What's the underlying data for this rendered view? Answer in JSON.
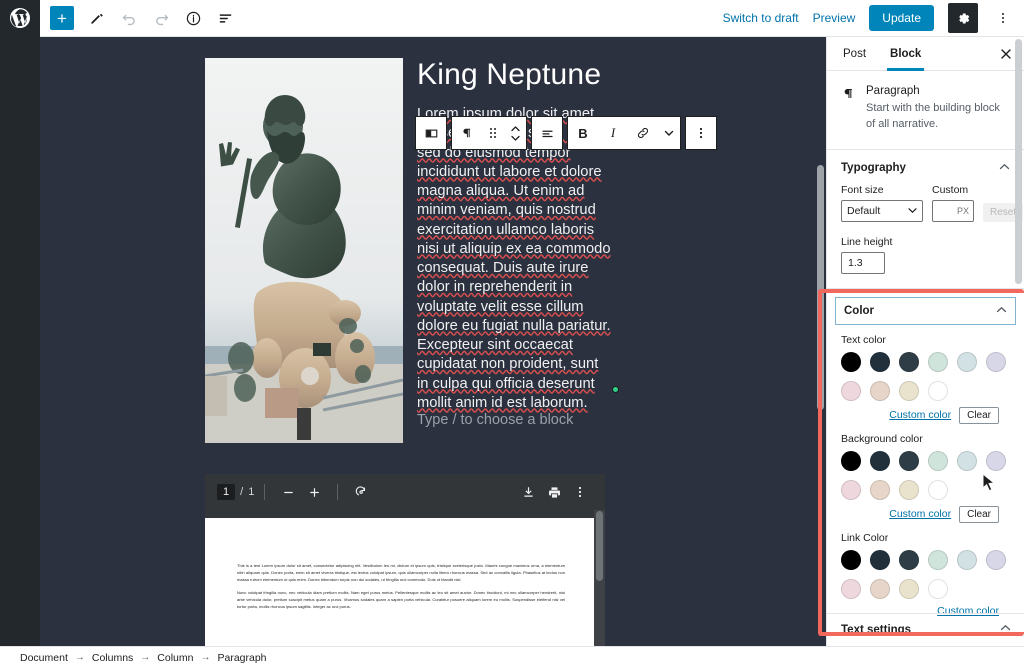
{
  "topbar": {
    "logo_icon": "wordpress-logo-icon",
    "add_block_label": "+",
    "tools": [
      {
        "name": "pencil-icon",
        "label": "Tools"
      },
      {
        "name": "undo-icon",
        "label": "Undo"
      },
      {
        "name": "redo-icon",
        "label": "Redo"
      },
      {
        "name": "info-icon",
        "label": "Content structure"
      },
      {
        "name": "list-view-icon",
        "label": "Block navigation"
      }
    ],
    "switch_to_draft": "Switch to draft",
    "preview": "Preview",
    "update": "Update",
    "settings_icon": "gear-icon",
    "more_icon": "kebab-menu-icon"
  },
  "block_toolbar": {
    "buttons": [
      {
        "name": "media-text-block-icon",
        "glyph": "▣"
      },
      {
        "name": "paragraph-block-icon",
        "glyph": "¶"
      },
      {
        "name": "drag-handle-icon",
        "glyph": "⁙"
      },
      {
        "name": "move-up-down-icon",
        "glyph": "↕"
      },
      {
        "name": "align-text-icon",
        "glyph": "≡"
      },
      {
        "name": "bold-icon",
        "glyph": "B"
      },
      {
        "name": "italic-icon",
        "glyph": "I"
      },
      {
        "name": "link-icon",
        "glyph": "∞"
      },
      {
        "name": "chevron-down-icon",
        "glyph": "∨"
      },
      {
        "name": "more-options-icon",
        "glyph": "⋮"
      }
    ]
  },
  "content": {
    "heading": "King Neptune",
    "image_alt": "King Neptune bronze statue by the sea",
    "paragraph": "Lorem ipsum dolor sit amet, consectetur adipiscing elit, sed do eiusmod tempor incididunt ut labore et dolore magna aliqua. Ut enim ad minim veniam, quis nostrud exercitation ullamco laboris nisi ut aliquip ex ea commodo consequat. Duis aute irure dolor in reprehenderit in voluptate velit esse cillum dolore eu fugiat nulla pariatur. Excepteur sint occaecat cupidatat non proident, sunt in culpa qui officia deserunt mollit anim id est laborum.",
    "empty_block_placeholder": "Type / to choose a block"
  },
  "pdf_viewer": {
    "current_page": "1",
    "page_separator": "/",
    "total_pages": "1",
    "zoom_out_icon": "minus-icon",
    "zoom_in_icon": "plus-icon",
    "rotate_icon": "rotate-icon",
    "download_icon": "download-icon",
    "print_icon": "print-icon",
    "more_icon": "kebab-menu-icon",
    "page_text": [
      "This is a test Lorem ipsum dolor sit amet, consectetur adipiscing elit. Vestibulum leo mi, dictum et ipsum quis, tristique scelerisque justo. Mauris congue maximus urna, a elementum nibh aliquam quis. Donec porta, enim sit amet viverra tristique, est lectus volutpat ipsum, quis ullamcorper nulla libero rhoncus massa. Sed ac convallis ligula. Phasellus at lectus non massa rutrum elementum ut quis enim. Donec bibendum turpis non dui sodales, ut fringilla orci commodo. Duis ut blandit nisl.",
      "Nunc volutpat fringilla nunc, nec vehicula diam pretium mollis. Nam eget purus metus. Pellentesque mollis ac leo sit amet auctor. Donec tincidunt, mi nec ullamcorper hendrerit, nisi ante vehicula dolor, pretium suscipit metus quam a purus. Vivamus sodales quam a sapien porta vehicula. Curabitur posuere aliquam lorem eu mollis. Suspendisse eleifend nisl vel tortor porta, mollis rhoncus ipsum sagittis. Integer ac orci purus."
    ]
  },
  "sidebar": {
    "tabs": [
      {
        "label": "Post",
        "active": false
      },
      {
        "label": "Block",
        "active": true
      }
    ],
    "close_icon": "close-icon",
    "block_card": {
      "icon": "paragraph-block-icon",
      "title": "Paragraph",
      "description": "Start with the building block of all narrative."
    },
    "typography": {
      "title": "Typography",
      "collapse_icon": "chevron-up-icon",
      "font_size_label": "Font size",
      "font_size_value": "Default",
      "custom_label": "Custom",
      "custom_unit": "PX",
      "custom_value": "",
      "reset_label": "Reset",
      "line_height_label": "Line height",
      "line_height_value": "1.3"
    },
    "color": {
      "title": "Color",
      "collapse_icon": "chevron-up-icon",
      "palette": [
        "#000000",
        "#22303c",
        "#2f3e46",
        "#cfe4da",
        "#d2e1e4",
        "#d8d7e8",
        "#eed8dd",
        "#e6d5c8",
        "#e9e3cd",
        "#ffffff"
      ],
      "groups": [
        {
          "label": "Text color",
          "custom_link": "Custom color",
          "clear_label": "Clear",
          "has_clear": true
        },
        {
          "label": "Background color",
          "custom_link": "Custom color",
          "clear_label": "Clear",
          "has_clear": true
        },
        {
          "label": "Link Color",
          "custom_link": "Custom color",
          "clear_label": "",
          "has_clear": false
        }
      ]
    },
    "text_settings": {
      "title": "Text settings",
      "collapse_icon": "chevron-up-icon"
    }
  },
  "breadcrumb": {
    "items": [
      "Document",
      "Columns",
      "Column",
      "Paragraph"
    ],
    "separator": "→"
  },
  "colors": {
    "accent": "#0085ba",
    "highlight_box": "#f2685c",
    "canvas_bg": "#2b313f",
    "rail_bg": "#23282d"
  }
}
